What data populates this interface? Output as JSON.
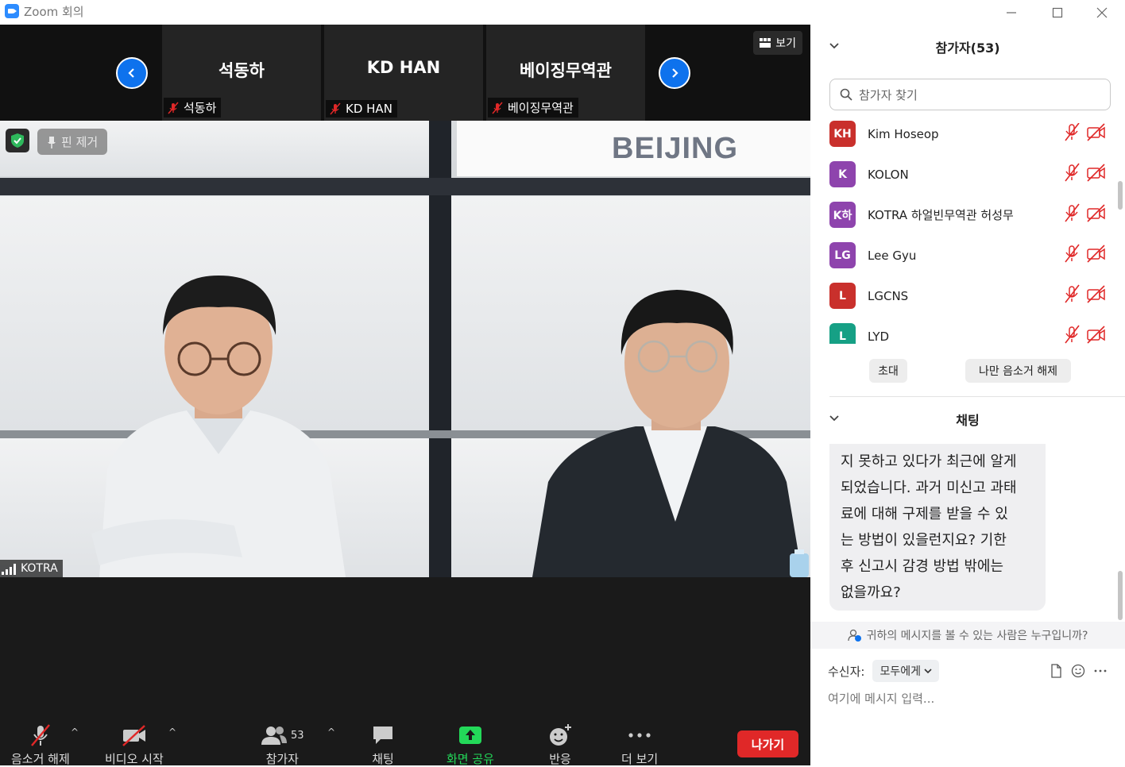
{
  "window": {
    "title": "Zoom 회의"
  },
  "strip": {
    "tiles": [
      {
        "name": "석동하",
        "label": "석동하"
      },
      {
        "name": "KD HAN",
        "label": "KD HAN"
      },
      {
        "name": "베이징무역관",
        "label": "베이징무역관"
      }
    ],
    "view_label": "보기"
  },
  "video": {
    "unpin_label": "핀 제거",
    "speaker_label": "KOTRA",
    "banner_text": "BEIJING"
  },
  "toolbar": {
    "unmute": "음소거 해제",
    "start_video": "비디오 시작",
    "participants": "참가자",
    "participants_count": "53",
    "chat": "채팅",
    "share": "화면 공유",
    "reactions": "반응",
    "more": "더 보기",
    "leave": "나가기"
  },
  "participants_panel": {
    "title": "참가자(53)",
    "search_placeholder": "참가자 찾기",
    "list": [
      {
        "initials": "KH",
        "name": "Kim Hoseop",
        "color": "#C9302C"
      },
      {
        "initials": "K",
        "name": "KOLON",
        "color": "#8E44AD"
      },
      {
        "initials": "K하",
        "name": "KOTRA 하얼빈무역관 허성무",
        "color": "#8E44AD"
      },
      {
        "initials": "LG",
        "name": "Lee Gyu",
        "color": "#8E44AD"
      },
      {
        "initials": "L",
        "name": "LGCNS",
        "color": "#C9302C"
      },
      {
        "initials": "L",
        "name": "LYD",
        "color": "#16A085"
      }
    ],
    "invite": "초대",
    "unmute_me": "나만 음소거 해제"
  },
  "chat_panel": {
    "title": "채팅",
    "message_lines": [
      "지 못하고 있다가 최근에 알게",
      "되었습니다. 과거 미신고 과태",
      "료에 대해 구제를 받을 수 있",
      "는 방법이 있을런지요? 기한",
      "후 신고시 감경 방법 밖에는",
      "없을까요?"
    ],
    "who_can_see": "귀하의 메시지를 볼 수 있는 사람은 누구입니까?",
    "to_label": "수신자:",
    "to_value": "모두에게",
    "input_placeholder": "여기에 메시지 입력..."
  },
  "colors": {
    "accent": "#0E72ED",
    "leave": "#E02828",
    "share": "#23D959",
    "muted": "#E02828"
  }
}
